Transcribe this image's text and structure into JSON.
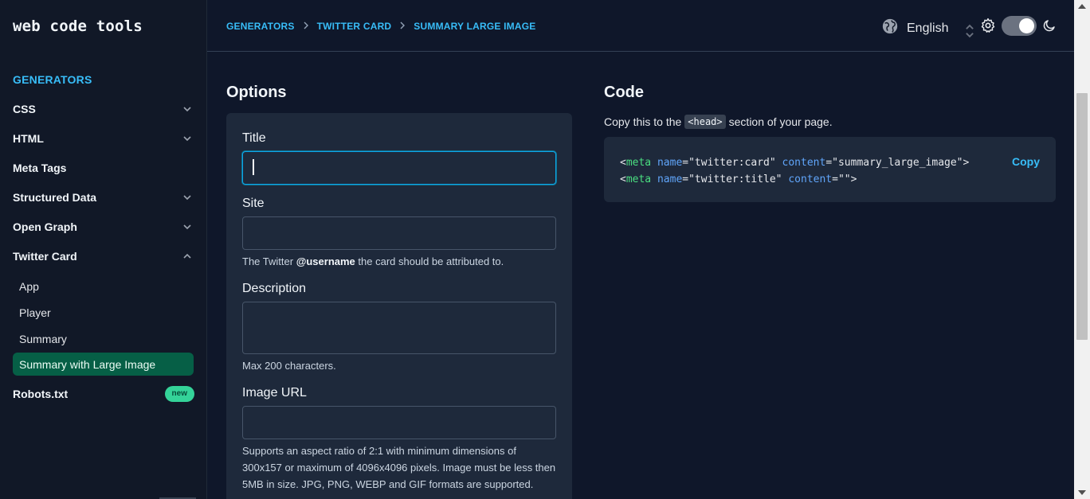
{
  "brand": "web code tools",
  "sidebar": {
    "heading": "GENERATORS",
    "items": [
      {
        "label": "CSS",
        "has_chevron": true,
        "expanded": false
      },
      {
        "label": "HTML",
        "has_chevron": true,
        "expanded": false
      },
      {
        "label": "Meta Tags",
        "has_chevron": false
      },
      {
        "label": "Structured Data",
        "has_chevron": true,
        "expanded": false
      },
      {
        "label": "Open Graph",
        "has_chevron": true,
        "expanded": false
      },
      {
        "label": "Twitter Card",
        "has_chevron": true,
        "expanded": true
      }
    ],
    "sub_items": [
      "App",
      "Player",
      "Summary",
      "Summary with Large Image"
    ],
    "active_sub_item": "Summary with Large Image",
    "robots": {
      "label": "Robots.txt",
      "badge": "new"
    }
  },
  "header": {
    "breadcrumb": [
      "GENERATORS",
      "TWITTER CARD",
      "SUMMARY LARGE IMAGE"
    ],
    "language": "English",
    "dark_mode": true
  },
  "options": {
    "title": "Options",
    "fields": {
      "title": {
        "label": "Title",
        "value": ""
      },
      "site": {
        "label": "Site",
        "value": "",
        "help_prefix": "The Twitter ",
        "help_bold": "@username",
        "help_suffix": " the card should be attributed to."
      },
      "description": {
        "label": "Description",
        "value": "",
        "help": "Max 200 characters."
      },
      "image_url": {
        "label": "Image URL",
        "value": "",
        "help": "Supports an aspect ratio of 2:1 with minimum dimensions of 300x157 or maximum of 4096x4096 pixels. Image must be less then 5MB in size. JPG, PNG, WEBP and GIF formats are supported."
      }
    }
  },
  "code": {
    "title": "Code",
    "desc_before": "Copy this to the",
    "desc_tag": "<head>",
    "desc_after": "section of your page.",
    "copy_label": "Copy",
    "lines": [
      {
        "tag": "meta",
        "attrs": [
          {
            "name": "name",
            "value": "twitter:card"
          },
          {
            "name": "content",
            "value": "summary_large_image"
          }
        ]
      },
      {
        "tag": "meta",
        "attrs": [
          {
            "name": "name",
            "value": "twitter:title"
          },
          {
            "name": "content",
            "value": ""
          }
        ]
      }
    ]
  },
  "colors": {
    "accent": "#38bdf8",
    "active_bg": "#065f46",
    "badge": "#34d399",
    "bg": "#0f172a",
    "card": "#1e293b"
  }
}
